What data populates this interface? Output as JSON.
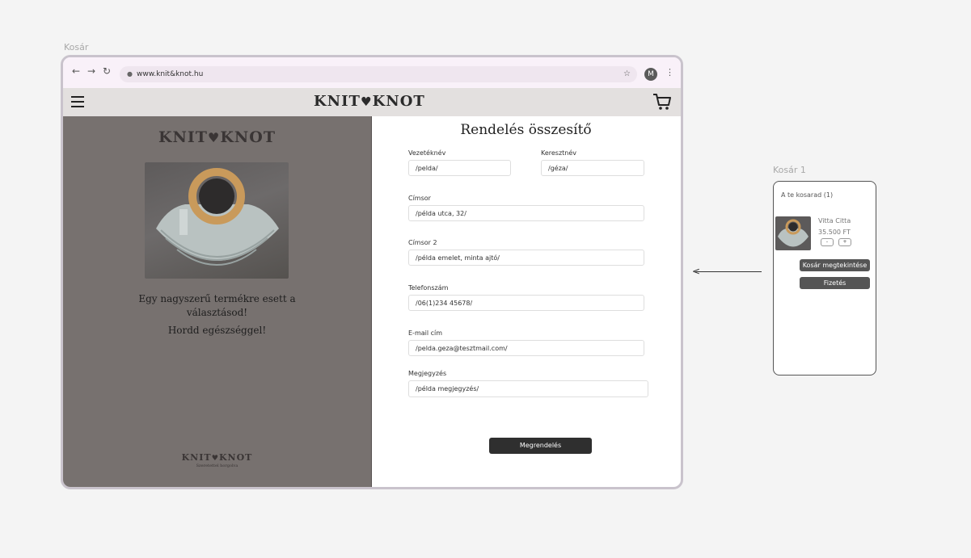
{
  "frames": {
    "main_label": "Kosár",
    "side_label": "Kosár 1"
  },
  "browser": {
    "url": "www.knit&knot.hu",
    "profile_initial": "M"
  },
  "brand": {
    "logo_left": "KNIT",
    "logo_right": "KNOT"
  },
  "left_panel": {
    "message_line1": "Egy nagyszerű termékre esett a",
    "message_line2": "választásod!",
    "message_line3": "Hordd egészséggel!",
    "footer_tagline": "Szeretettel horgolva"
  },
  "form": {
    "title": "Rendelés összesítő",
    "fields": [
      {
        "label": "Vezetéknév",
        "value": "/pelda/"
      },
      {
        "label": "Keresztnév",
        "value": "/géza/"
      },
      {
        "label": "Címsor",
        "value": "/példa utca, 32/"
      },
      {
        "label": "Címsor 2",
        "value": "/példa emelet, minta ajtó/"
      },
      {
        "label": "Telefonszám",
        "value": "/06(1)234 45678/"
      },
      {
        "label": "E-mail cím",
        "value": "/pelda.geza@tesztmail.com/"
      },
      {
        "label": "Megjegyzés",
        "value": "/példa megjegyzés/"
      }
    ],
    "submit_label": "Megrendelés"
  },
  "cart": {
    "title": "A te kosarad (1)",
    "item_name": "Vitta Citta",
    "item_price": "35.500 FT",
    "qty_minus": "-",
    "qty_plus": "+",
    "view_cart_label": "Kosár megtekintése",
    "checkout_label": "Fizetés"
  },
  "icons": {
    "back": "arrow-left-icon",
    "forward": "arrow-right-icon",
    "reload": "reload-icon",
    "lock": "lock-icon",
    "bookmark": "star-icon",
    "menu": "hamburger-menu-icon",
    "cart": "shopping-cart-icon",
    "logo_heart": "yarn-heart-icon"
  },
  "colors": {
    "page_bg": "#f4f4f4",
    "browser_frame": "#c9c3cc",
    "chrome_bar": "#f9f1f9",
    "site_header": "#e3e0df",
    "left_panel": "#77716f",
    "submit_button": "#2f2f2f",
    "cart_button": "#555555"
  }
}
